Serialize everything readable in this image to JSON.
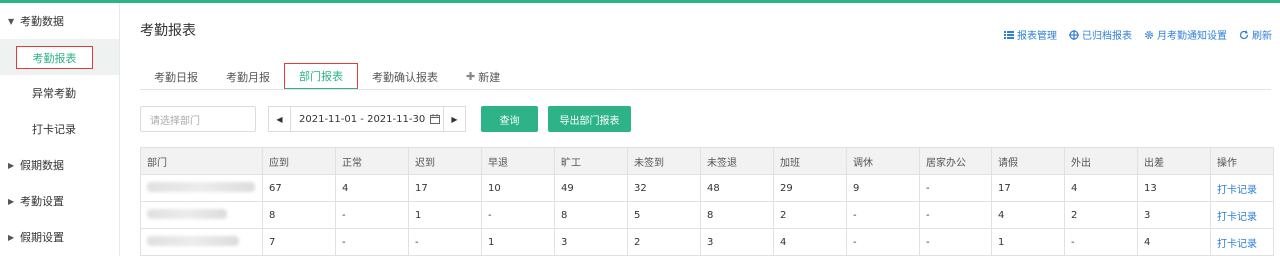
{
  "sidebar": {
    "groups": [
      {
        "label": "考勤数据",
        "expanded": true
      },
      {
        "label": "假期数据",
        "expanded": false
      },
      {
        "label": "考勤设置",
        "expanded": false
      },
      {
        "label": "假期设置",
        "expanded": false
      }
    ],
    "sub_items": [
      "考勤报表",
      "异常考勤",
      "打卡记录"
    ]
  },
  "header": {
    "title": "考勤报表",
    "actions": [
      "报表管理",
      "已归档报表",
      "月考勤通知设置",
      "刷新"
    ]
  },
  "tabs": [
    "考勤日报",
    "考勤月报",
    "部门报表",
    "考勤确认报表",
    "新建"
  ],
  "filters": {
    "dept_placeholder": "请选择部门",
    "date_range": "2021-11-01 - 2021-11-30",
    "query_label": "查询",
    "export_label": "导出部门报表"
  },
  "table": {
    "headers": [
      "部门",
      "应到",
      "正常",
      "迟到",
      "早退",
      "旷工",
      "未签到",
      "未签退",
      "加班",
      "调休",
      "居家办公",
      "请假",
      "外出",
      "出差",
      "操作"
    ],
    "rows": [
      [
        "67",
        "4",
        "17",
        "10",
        "49",
        "32",
        "48",
        "29",
        "9",
        "-",
        "17",
        "4",
        "13",
        "打卡记录"
      ],
      [
        "8",
        "-",
        "1",
        "-",
        "8",
        "5",
        "8",
        "2",
        "-",
        "-",
        "4",
        "2",
        "3",
        "打卡记录"
      ],
      [
        "7",
        "-",
        "-",
        "1",
        "3",
        "2",
        "3",
        "4",
        "-",
        "-",
        "1",
        "-",
        "4",
        "打卡记录"
      ]
    ]
  },
  "colors": {
    "accent": "#2db387",
    "link": "#2f7fd8",
    "highlight_border": "#e23b3b"
  }
}
